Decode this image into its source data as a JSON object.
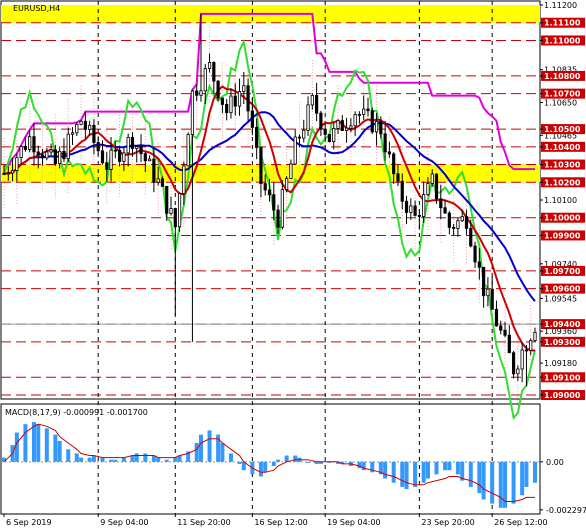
{
  "chart_data": [
    {
      "type": "candlestick",
      "title": "EURUSD,H4",
      "x_labels": [
        "6 Sep 2019",
        "9 Sep 04:00",
        "11 Sep 20:00",
        "16 Sep 12:00",
        "19 Sep 04:00",
        "23 Sep 20:00",
        "26 Sep 12:00"
      ],
      "ylim": [
        1.09,
        1.112
      ],
      "y_ticks": [
        "1.11200",
        "1.11100",
        "1.11000",
        "1.10835",
        "1.10800",
        "1.10700",
        "1.10650",
        "1.10465",
        "1.10500",
        "1.10400",
        "1.10300",
        "1.10200",
        "1.10100",
        "1.10000",
        "1.09900",
        "1.09740",
        "1.09700",
        "1.09600",
        "1.09545",
        "1.09400",
        "1.09360",
        "1.09300",
        "1.09180",
        "1.09100",
        "1.09000"
      ],
      "resistance_levels": [
        "1.11100",
        "1.11000",
        "1.10800",
        "1.10700",
        "1.10500",
        "1.10400",
        "1.10300",
        "1.10200",
        "1.10000",
        "1.09900",
        "1.09700",
        "1.09600",
        "1.09400",
        "1.09300",
        "1.09100",
        "1.09000"
      ],
      "highlight_band": [
        1.102,
        1.103
      ],
      "top_band": [
        1.111,
        1.112
      ],
      "price_line": 1.094,
      "colors": {
        "band": "#ffff00",
        "level_line": "#cc0000",
        "badge": "#cc0000",
        "close_ma": "#cc0000",
        "blue_ma": "#0000cc",
        "magenta": "#e000e0",
        "green": "#33dd33",
        "cloud": "#f0a0a0"
      }
    },
    {
      "type": "histogram",
      "title": "MACD(8,17,9) -0.000991 -0.001700",
      "y_ticks": [
        "0.00",
        "-0.002297"
      ],
      "series": [
        {
          "name": "MACD",
          "values": [
            0.0002,
            0.0008,
            0.0014,
            0.0018,
            0.0019,
            0.0018,
            0.0016,
            0.0013,
            0.001,
            0.0006,
            0.0004,
            0.0002,
            0.0002,
            0.0003,
            0.0002,
            0.0001,
            0.0001,
            0.0002,
            0.0003,
            0.0004,
            0.0004,
            0.0003,
            0.0002,
            0.0001,
            0.0002,
            0.0003,
            0.0005,
            0.0009,
            0.0013,
            0.0015,
            0.0013,
            0.0009,
            0.0004,
            -0.0001,
            -0.0004,
            -0.0006,
            -0.0007,
            -0.0005,
            -0.0002,
            0.0001,
            0.0003,
            0.0003,
            0.0002,
            0.0,
            -0.0001,
            -0.0001,
            0.0,
            -0.0001,
            -0.0001,
            -0.0002,
            -0.0003,
            -0.0004,
            -0.0005,
            -0.0006,
            -0.0008,
            -0.001,
            -0.0012,
            -0.0013,
            -0.0012,
            -0.001,
            -0.0008,
            -0.0006,
            -0.0004,
            -0.0004,
            -0.0006,
            -0.0009,
            -0.0012,
            -0.0015,
            -0.0018,
            -0.002,
            -0.0022,
            -0.0022,
            -0.002,
            -0.0016,
            -0.0012,
            -0.001
          ]
        },
        {
          "name": "Signal",
          "values": [
            0.0,
            0.0004,
            0.0009,
            0.0014,
            0.0017,
            0.0018,
            0.0017,
            0.0015,
            0.0012,
            0.0009,
            0.0006,
            0.0004,
            0.0003,
            0.0003,
            0.0002,
            0.0002,
            0.0002,
            0.0002,
            0.0003,
            0.0003,
            0.0003,
            0.0003,
            0.0002,
            0.0002,
            0.0002,
            0.0003,
            0.0004,
            0.0006,
            0.0009,
            0.0011,
            0.0011,
            0.0009,
            0.0006,
            0.0003,
            0.0,
            -0.0003,
            -0.0005,
            -0.0005,
            -0.0004,
            -0.0002,
            0.0,
            0.0001,
            0.0001,
            0.0001,
            0.0,
            0.0,
            0.0,
            0.0,
            -0.0001,
            -0.0001,
            -0.0002,
            -0.0003,
            -0.0004,
            -0.0005,
            -0.0006,
            -0.0007,
            -0.0009,
            -0.001,
            -0.0011,
            -0.0011,
            -0.001,
            -0.0009,
            -0.0008,
            -0.0007,
            -0.0007,
            -0.0008,
            -0.0009,
            -0.0011,
            -0.0013,
            -0.0015,
            -0.0017,
            -0.0019,
            -0.0019,
            -0.0018,
            -0.0017,
            -0.0017
          ]
        }
      ]
    }
  ]
}
